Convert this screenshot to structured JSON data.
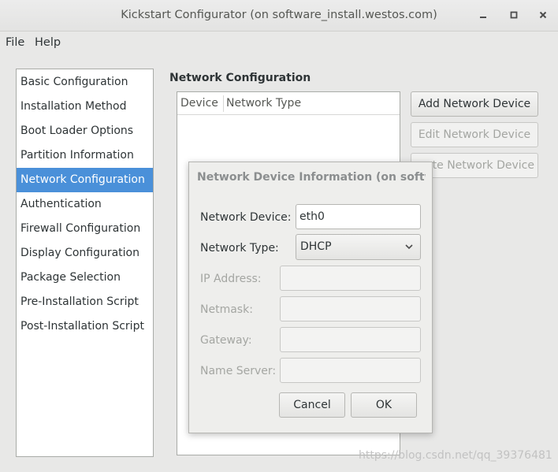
{
  "window": {
    "title": "Kickstart Configurator (on software_install.westos.com)",
    "controls": [
      "minimize-icon",
      "maximize-icon",
      "close-icon"
    ]
  },
  "menubar": {
    "file": "File",
    "help": "Help"
  },
  "sidebar": {
    "items": [
      {
        "label": "Basic Configuration"
      },
      {
        "label": "Installation Method"
      },
      {
        "label": "Boot Loader Options"
      },
      {
        "label": "Partition Information"
      },
      {
        "label": "Network Configuration",
        "selected": true
      },
      {
        "label": "Authentication"
      },
      {
        "label": "Firewall Configuration"
      },
      {
        "label": "Display Configuration"
      },
      {
        "label": "Package Selection"
      },
      {
        "label": "Pre-Installation Script"
      },
      {
        "label": "Post-Installation Script"
      }
    ]
  },
  "main": {
    "section_title": "Network Configuration",
    "table": {
      "columns": [
        "Device",
        "Network Type"
      ],
      "rows": []
    },
    "buttons": {
      "add": "Add Network Device",
      "edit": "Edit Network Device",
      "delete": "ete Network Device"
    }
  },
  "dialog": {
    "title": "Network Device Information (on softwar...",
    "fields": {
      "device_label": "Network Device:",
      "device_value": "eth0",
      "type_label": "Network Type:",
      "type_value": "DHCP",
      "ip_label": "IP Address:",
      "netmask_label": "Netmask:",
      "gateway_label": "Gateway:",
      "nameserver_label": "Name Server:"
    },
    "buttons": {
      "cancel": "Cancel",
      "ok": "OK"
    }
  },
  "watermark": "https://blog.csdn.net/qq_39376481"
}
